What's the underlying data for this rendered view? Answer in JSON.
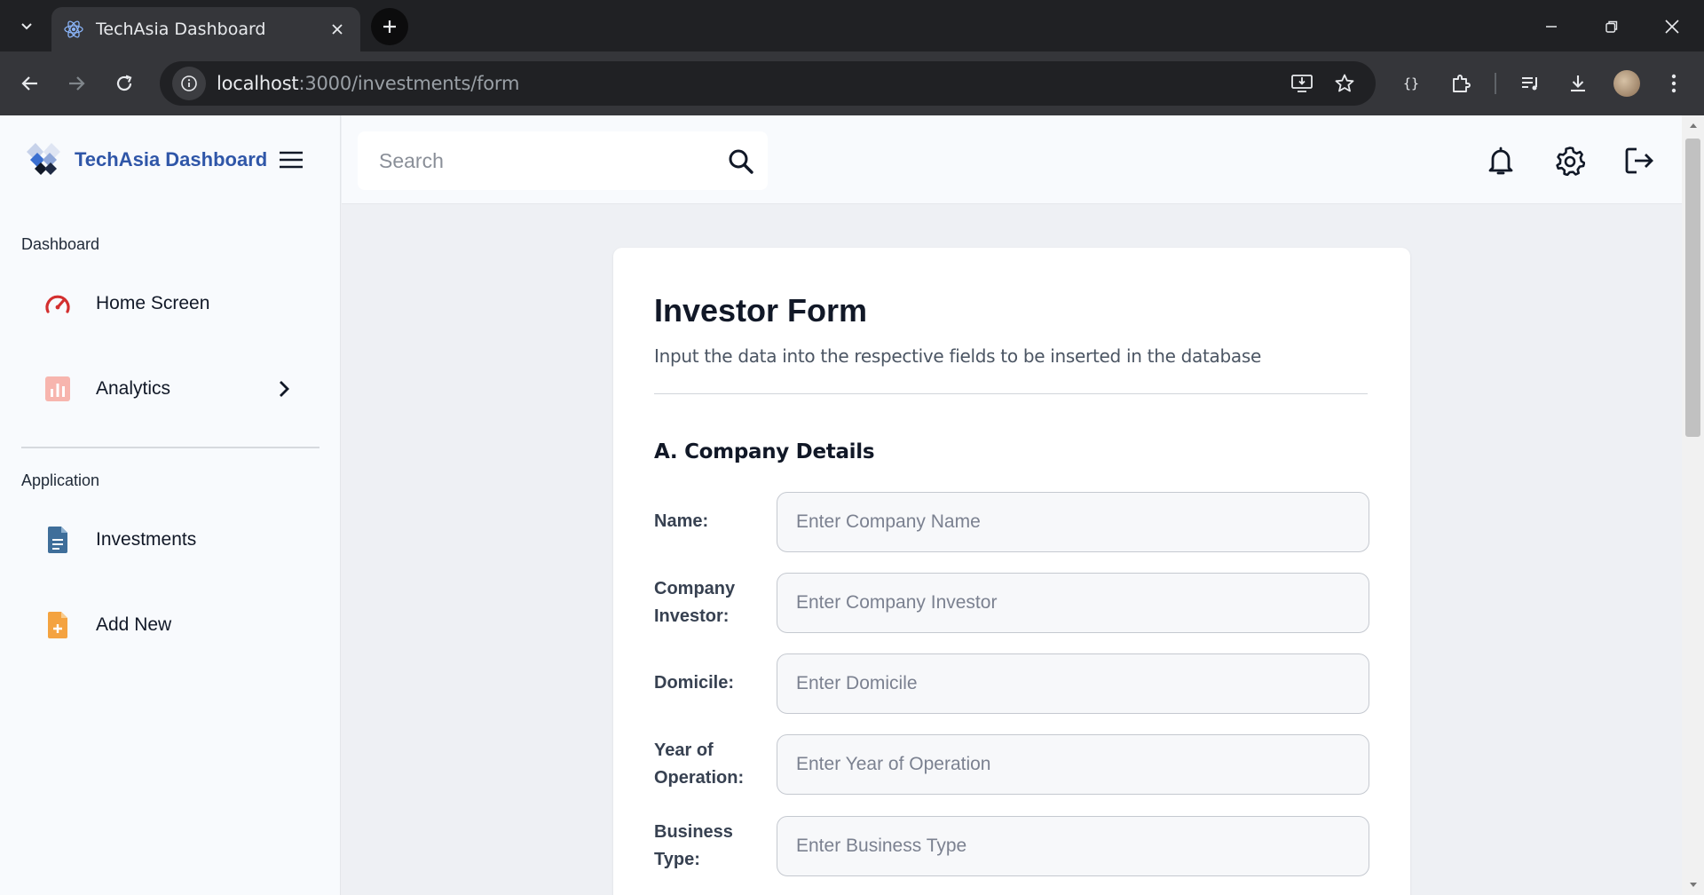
{
  "browser": {
    "tab_title": "TechAsia Dashboard",
    "url_host": "localhost",
    "url_rest": ":3000/investments/form"
  },
  "sidebar": {
    "brand": "TechAsia Dashboard",
    "sections": [
      {
        "label": "Dashboard"
      },
      {
        "label": "Application"
      }
    ],
    "items": [
      {
        "label": "Home Screen",
        "icon": "gauge-icon",
        "color": "#d32f2f"
      },
      {
        "label": "Analytics",
        "icon": "bar-chart-icon",
        "color": "#f28b82"
      },
      {
        "label": "Investments",
        "icon": "document-icon",
        "color": "#3f6e9a"
      },
      {
        "label": "Add New",
        "icon": "file-add-icon",
        "color": "#f4a340"
      }
    ]
  },
  "topbar": {
    "search_placeholder": "Search"
  },
  "form": {
    "title": "Investor Form",
    "subtitle": "Input the data into the respective fields to be inserted in the database",
    "section": "A. Company Details",
    "fields": [
      {
        "label_line1": "Name:",
        "label_line2": "",
        "placeholder": "Enter Company Name"
      },
      {
        "label_line1": "Company",
        "label_line2": "Investor:",
        "placeholder": "Enter Company Investor"
      },
      {
        "label_line1": "Domicile:",
        "label_line2": "",
        "placeholder": "Enter Domicile"
      },
      {
        "label_line1": "Year of",
        "label_line2": "Operation:",
        "placeholder": "Enter Year of Operation"
      },
      {
        "label_line1": "Business",
        "label_line2": "Type:",
        "placeholder": "Enter Business Type"
      }
    ]
  }
}
